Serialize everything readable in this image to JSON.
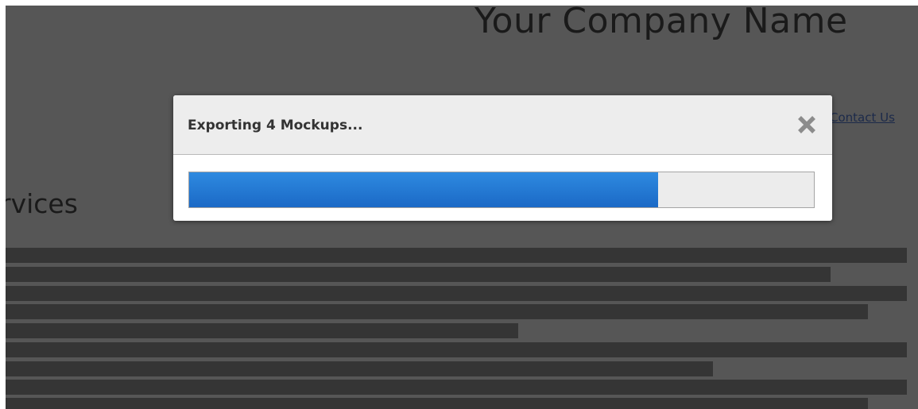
{
  "background_page": {
    "company_name": "Your Company Name",
    "contact_link": "Contact Us",
    "section_heading": "rvices",
    "placeholder_lines": 8
  },
  "modal": {
    "title": "Exporting 4 Mockups...",
    "close_icon": "close-x-icon",
    "progress_fraction": 0.75
  },
  "colors": {
    "overlay": "#565656",
    "text_bars": "#353535",
    "progress_blue": "#2277cc",
    "progress_track": "#ececec"
  }
}
